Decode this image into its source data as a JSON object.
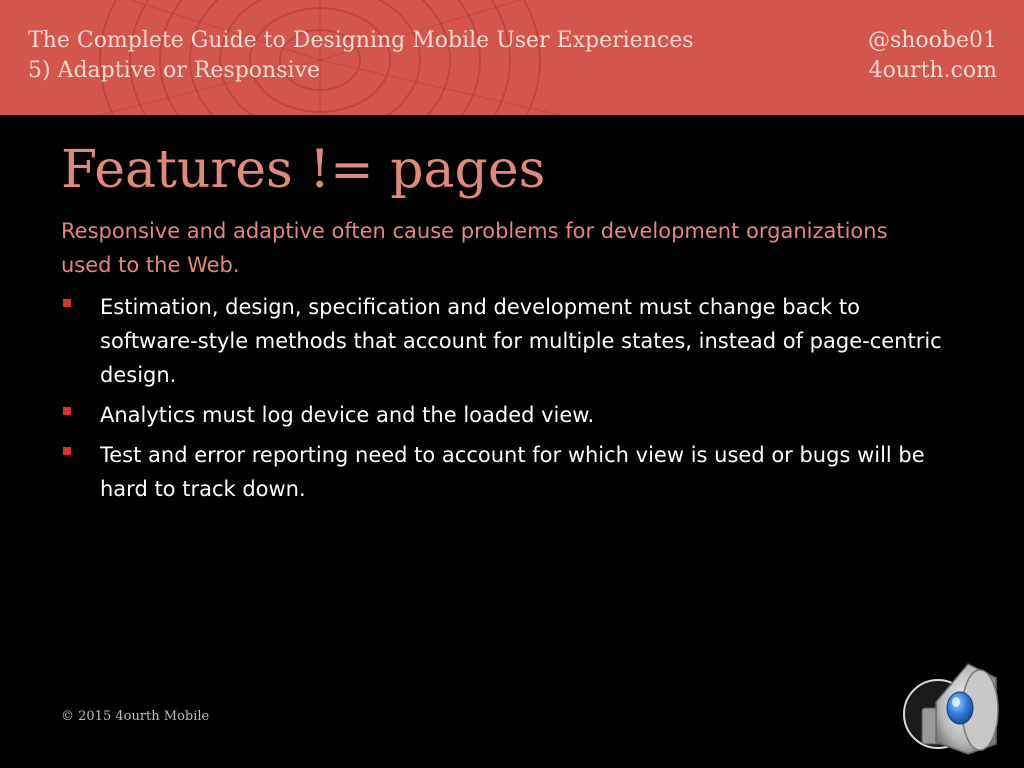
{
  "header": {
    "course_title": "The Complete Guide to Designing Mobile User Experiences",
    "section": "5) Adaptive or Responsive",
    "handle": "@shoobe01",
    "website": "4ourth.com"
  },
  "slide": {
    "title": "Features != pages",
    "intro": "Responsive and adaptive often cause problems for development organizations used to the Web.",
    "bullets": [
      "Estimation, design, specification and development must change back to software-style methods that account for multiple states, instead of page-centric design.",
      "Analytics must log device and the loaded view.",
      "Test and error reporting need to account for which view is used or bugs will be hard to track down."
    ]
  },
  "footer": {
    "copyright": "© 2015 4ourth Mobile"
  },
  "icons": {
    "audio": "speaker-icon",
    "bullet": "square-bullet-icon"
  },
  "colors": {
    "header_band": "#d4564a",
    "accent_text": "#e2897a",
    "bullet": "#e0302c",
    "background": "#000000"
  }
}
